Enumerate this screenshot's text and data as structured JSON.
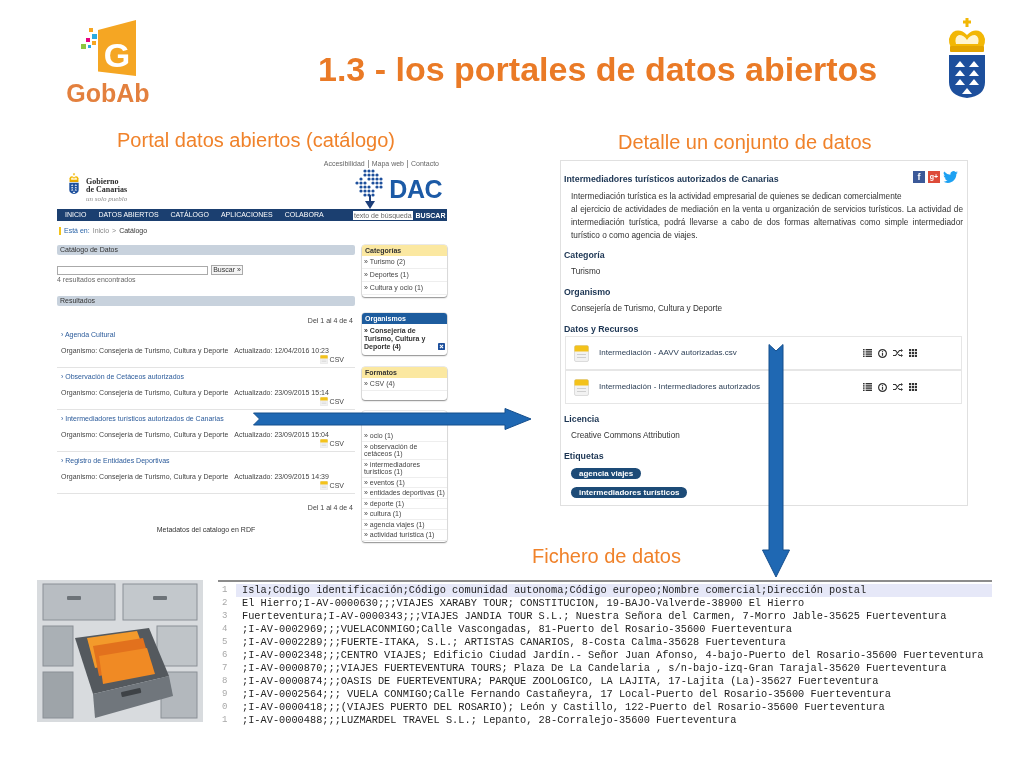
{
  "header": {
    "logo_mark": "G",
    "logo_text": "GobAb",
    "title": "1.3 - los portales de datos abiertos"
  },
  "catalog_panel": {
    "caption": "Portal datos abiertos (catálogo)",
    "site": {
      "top_links": [
        "Accesibilidad",
        "Mapa web",
        "Contacto"
      ],
      "name": "Gobierno\nde Canarias",
      "motto": "un solo pueblo",
      "logo_text": "DAC",
      "nav": [
        "INICIO",
        "DATOS ABIERTOS",
        "CATÁLOGO",
        "APLICACIONES",
        "COLABORA"
      ],
      "search": {
        "placeholder": "texto de búsqueda",
        "button": "BUSCAR"
      },
      "breadcrumb": {
        "label": "Está en:",
        "items": [
          "Inicio",
          "Catálogo"
        ],
        "separator": ">"
      }
    },
    "catalog": {
      "heading": "Catálogo de Datos",
      "search_button": "Buscar »",
      "result_count": "4 resultados encontrados",
      "results_heading": "Resultados",
      "pagination_top": "Del 1 al 4 de 4",
      "results": [
        {
          "title": "› Agenda Cultural",
          "organism": "Organismo: Consejería de Turismo, Cultura y Deporte",
          "updated": "Actualizado: 12/04/2016 10:23",
          "format": "CSV"
        },
        {
          "title": "› Observación de Cetáceos autorizados",
          "organism": "Organismo: Consejería de Turismo, Cultura y Deporte",
          "updated": "Actualizado: 23/09/2015 15:14",
          "format": "CSV"
        },
        {
          "title": "› Intermediadores turísticos autorizados de Canarias",
          "organism": "Organismo: Consejería de Turismo, Cultura y Deporte",
          "updated": "Actualizado: 23/09/2015 15:04",
          "format": "CSV"
        },
        {
          "title": "› Registro de Entidades Deportivas",
          "organism": "Organismo: Consejería de Turismo, Cultura y Deporte",
          "updated": "Actualizado: 23/09/2015 14:39",
          "format": "CSV"
        }
      ],
      "pagination_bottom": "Del 1 al 4 de 4",
      "rdf_link": "Metadatos del catalogo en RDF"
    },
    "facets": [
      {
        "heading": "Categorías",
        "active": false,
        "items": [
          {
            "label": "» Turismo (2)"
          },
          {
            "label": "» Deportes (1)"
          },
          {
            "label": "» Cultura y ocio (1)"
          }
        ]
      },
      {
        "heading": "Organismos",
        "active": true,
        "items": [
          {
            "label": "» Consejería de Turismo, Cultura y Deporte (4)",
            "removable": true
          }
        ]
      },
      {
        "heading": "Formatos",
        "active": false,
        "items": [
          {
            "label": "» CSV (4)"
          }
        ]
      },
      {
        "items": [
          {
            "label": "» ocio (1)"
          },
          {
            "label": "» observación de cetáceos (1)"
          },
          {
            "label": "» intermediadores turísticos (1)"
          },
          {
            "label": "» eventos (1)"
          },
          {
            "label": "» entidades deportivas (1)"
          },
          {
            "label": "» deporte (1)"
          },
          {
            "label": "» cultura (1)"
          },
          {
            "label": "» agencia viajes (1)"
          },
          {
            "label": "» actividad turística (1)"
          }
        ]
      }
    ]
  },
  "detail_panel": {
    "caption": "Detalle un conjunto de datos",
    "share": [
      {
        "kind": "facebook",
        "label": "f"
      },
      {
        "kind": "google",
        "label": "g+"
      },
      {
        "kind": "twitter"
      }
    ],
    "title": "Intermediadores turísticos autorizados de Canarias",
    "description": "Intermediación turística es la actividad empresarial de quienes se dedican comercialmente\nal ejercicio de actividades de mediación en la venta u organización de servicios turísticos. La actividad de intermediación turística, podrá llevarse a cabo de dos formas alternativas como simple intermediador turístico o como agencia de viajes.",
    "sections": [
      {
        "kind": "text",
        "heading": "Categoría",
        "value": "Turismo"
      },
      {
        "kind": "text",
        "heading": "Organismo",
        "value": "Consejería de Turismo, Cultura y Deporte"
      },
      {
        "kind": "resources",
        "heading": "Datos y Recursos",
        "items": [
          {
            "name": "Intermediación - AAVV autorizadas.csv"
          },
          {
            "name": "Intermediación - Intermediadores autorizados"
          }
        ]
      },
      {
        "kind": "text",
        "heading": "Licencia",
        "value": "Creative Commons Attribution"
      },
      {
        "kind": "tags",
        "heading": "Etiquetas",
        "items": [
          "agencia viajes",
          "intermediadores turísticos"
        ]
      }
    ]
  },
  "file_panel": {
    "caption": "Fichero de datos",
    "lines": [
      {
        "number": "1",
        "text": "Isla;Codigo identificación;Código comunidad autonoma;Código europeo;Nombre comercial;Dirección postal",
        "selected": true
      },
      {
        "number": "2",
        "text": "El Hierro;I-AV-0000630;;;VIAJES XARABY TOUR; CONSTITUCION, 19-BAJO-Valverde-38900 El Hierro",
        "selected": false
      },
      {
        "number": "3",
        "text": "Fuerteventura;I-AV-0000343;;;VIAJES JANDIA TOUR S.L.; Nuestra Señora del Carmen, 7-Morro Jable-35625 Fuerteventura",
        "selected": false
      },
      {
        "number": "4",
        "text": ";I-AV-0002969;;;VUELACONMIGO;Calle Vascongadas, 81-Puerto del Rosario-35600 Fuerteventura",
        "selected": false
      },
      {
        "number": "5",
        "text": ";I-AV-0002289;;;FUERTE-ITAKA, S.L.; ARTISTAS CANARIOS, 8-Costa Calma-35628 Fuerteventura",
        "selected": false
      },
      {
        "number": "6",
        "text": ";I-AV-0002348;;;CENTRO VIAJES; Edificio Ciudad Jardín.- Señor Juan Afonso, 4-bajo-Puerto del Rosario-35600 Fuerteventura",
        "selected": false
      },
      {
        "number": "7",
        "text": ";I-AV-0000870;;;VIAJES FUERTEVENTURA TOURS; Plaza De La Candelaria , s/n-bajo-izq-Gran Tarajal-35620 Fuerteventura",
        "selected": false
      },
      {
        "number": "8",
        "text": ";I-AV-0000874;;;OASIS DE FUERTEVENTURA; PARQUE ZOOLOGICO, LA LAJITA, 17-Lajita (La)-35627 Fuerteventura",
        "selected": false
      },
      {
        "number": "9",
        "text": ";I-AV-0002564;;; VUELA CONMIGO;Calle Fernando Castañeyra, 17 Local-Puerto del Rosario-35600 Fuerteventura",
        "selected": false
      },
      {
        "number": "0",
        "text": ";I-AV-0000418;;;(VIAJES PUERTO DEL ROSARIO); León y Castillo, 122-Puerto del Rosario-35600 Fuerteventura",
        "selected": false
      },
      {
        "number": "1",
        "text": ";I-AV-0000488;;;LUZMARDEL TRAVEL S.L.; Lepanto, 28-Corralejo-35600 Fuerteventura",
        "selected": false
      }
    ]
  }
}
